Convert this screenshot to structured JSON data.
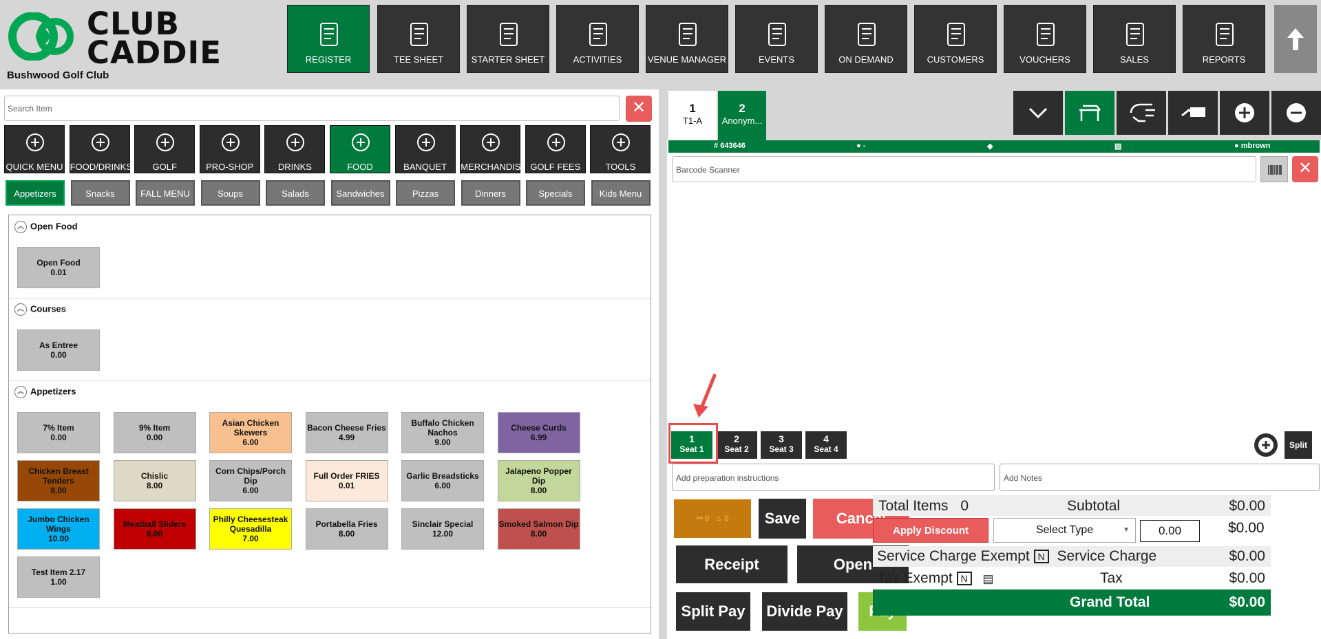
{
  "header": {
    "brand_line1": "CLUB",
    "brand_line2": "CADDIE",
    "club_name": "Bushwood Golf Club",
    "nav": [
      {
        "label": "REGISTER",
        "icon": "barcode-scanner-icon",
        "active": true
      },
      {
        "label": "TEE SHEET",
        "icon": "tee-flag-icon"
      },
      {
        "label": "STARTER SHEET",
        "icon": "tablet-icon"
      },
      {
        "label": "ACTIVITIES",
        "icon": "calendar-list-icon"
      },
      {
        "label": "VENUE MANAGER",
        "icon": "meeting-table-icon"
      },
      {
        "label": "EVENTS",
        "icon": "calendar-edit-icon"
      },
      {
        "label": "ON DEMAND",
        "icon": "mobile-signal-icon"
      },
      {
        "label": "CUSTOMERS",
        "icon": "users-icon"
      },
      {
        "label": "VOUCHERS",
        "icon": "voucher-icon"
      },
      {
        "label": "SALES",
        "icon": "money-hand-icon"
      },
      {
        "label": "REPORTS",
        "icon": "report-icon"
      }
    ]
  },
  "left": {
    "search_placeholder": "Search Item",
    "categories": [
      {
        "label": "QUICK MENU",
        "icon": "star-icon"
      },
      {
        "label": "FOOD/DRINKS",
        "icon": "food-drink-icon"
      },
      {
        "label": "GOLF",
        "icon": "golf-icon"
      },
      {
        "label": "PRO-SHOP",
        "icon": "tag-icon"
      },
      {
        "label": "DRINKS",
        "icon": "beer-icon"
      },
      {
        "label": "FOOD",
        "icon": "burger-icon",
        "active": true
      },
      {
        "label": "BANQUET",
        "icon": "menu-doc-icon"
      },
      {
        "label": "MERCHANDISE",
        "icon": "tag-icon"
      },
      {
        "label": "GOLF FEES",
        "icon": "golf-cart-icon"
      },
      {
        "label": "TOOLS",
        "icon": "tools-icon"
      }
    ],
    "subcategories": [
      "Appetizers",
      "Snacks",
      "FALL MENU",
      "Soups",
      "Salads",
      "Sandwiches",
      "Pizzas",
      "Dinners",
      "Specials",
      "Kids Menu"
    ],
    "sections": [
      {
        "title": "Open Food",
        "items": [
          {
            "name": "Open Food",
            "price": "0.01",
            "color": "#bfbfbf"
          }
        ]
      },
      {
        "title": "Courses",
        "items": [
          {
            "name": "As Entree",
            "price": "0.00",
            "color": "#bfbfbf"
          }
        ]
      },
      {
        "title": "Appetizers",
        "items": [
          {
            "name": "7% Item",
            "price": "0.00",
            "color": "#bfbfbf"
          },
          {
            "name": "9% Item",
            "price": "0.00",
            "color": "#bfbfbf"
          },
          {
            "name": "Asian Chicken Skewers",
            "price": "6.00",
            "color": "#f9c08f"
          },
          {
            "name": "Bacon Cheese Fries",
            "price": "4.99",
            "color": "#bfbfbf"
          },
          {
            "name": "Buffalo Chicken Nachos",
            "price": "9.00",
            "color": "#bfbfbf"
          },
          {
            "name": "Cheese Curds",
            "price": "6.99",
            "color": "#8064a2"
          },
          {
            "name": "Chicken Breast Tenders",
            "price": "8.00",
            "color": "#974806"
          },
          {
            "name": "Chislic",
            "price": "8.00",
            "color": "#ddd9c4"
          },
          {
            "name": "Corn Chips/Porch Dip",
            "price": "6.00",
            "color": "#bfbfbf"
          },
          {
            "name": "Full Order FRIES",
            "price": "0.01",
            "color": "#fde9d9"
          },
          {
            "name": "Garlic Breadsticks",
            "price": "6.00",
            "color": "#bfbfbf"
          },
          {
            "name": "Jalapeno Popper Dip",
            "price": "8.00",
            "color": "#c4d79b"
          },
          {
            "name": "Jumbo Chicken Wings",
            "price": "10.00",
            "color": "#00b0f0"
          },
          {
            "name": "Meatball Sliders",
            "price": "9.00",
            "color": "#c00000"
          },
          {
            "name": "Philly Cheesesteak Quesadilla",
            "price": "7.00",
            "color": "#ffff00"
          },
          {
            "name": "Portabella Fries",
            "price": "8.00",
            "color": "#bfbfbf"
          },
          {
            "name": "Sinclair Special",
            "price": "12.00",
            "color": "#bfbfbf"
          },
          {
            "name": "Smoked Salmon Dip",
            "price": "8.00",
            "color": "#c0504d"
          },
          {
            "name": "Test Item 2.17",
            "price": "1.00",
            "color": "#bfbfbf"
          }
        ]
      }
    ]
  },
  "right": {
    "tabs": [
      {
        "num": "1",
        "label": "T1-A"
      },
      {
        "num": "2",
        "label": "Anonym..."
      }
    ],
    "info": {
      "ticket": "643646",
      "guest": "-",
      "user": "mbrown"
    },
    "barcode_placeholder": "Barcode Scanner",
    "seats": [
      {
        "num": "1",
        "label": "Seat 1",
        "active": true
      },
      {
        "num": "2",
        "label": "Seat 2"
      },
      {
        "num": "3",
        "label": "Seat 3"
      },
      {
        "num": "4",
        "label": "Seat 4"
      }
    ],
    "split_label": "Split",
    "prep_placeholder": "Add preparation instructions",
    "notes_placeholder": "Add Notes",
    "orange_counts": [
      "0",
      "0"
    ],
    "buttons": {
      "save": "Save",
      "cancel": "Cancel",
      "receipt": "Receipt",
      "open": "Open",
      "split_pay": "Split Pay",
      "divide_pay": "Divide Pay",
      "pay": "Pay"
    },
    "totals": {
      "total_items_label": "Total Items",
      "total_items": "0",
      "subtotal_label": "Subtotal",
      "subtotal": "$0.00",
      "apply_discount": "Apply Discount",
      "select_type": "Select Type",
      "discount_value": "0.00",
      "discount_amount": "$0.00",
      "service_charge_exempt_label": "Service Charge Exempt",
      "service_charge_exempt_flag": "N",
      "service_charge_label": "Service Charge",
      "service_charge": "$0.00",
      "tax_exempt_label": "Tax Exempt",
      "tax_exempt_flag": "N",
      "tax_label": "Tax",
      "tax": "$0.00",
      "grand_total_label": "Grand Total",
      "grand_total": "$0.00"
    }
  }
}
